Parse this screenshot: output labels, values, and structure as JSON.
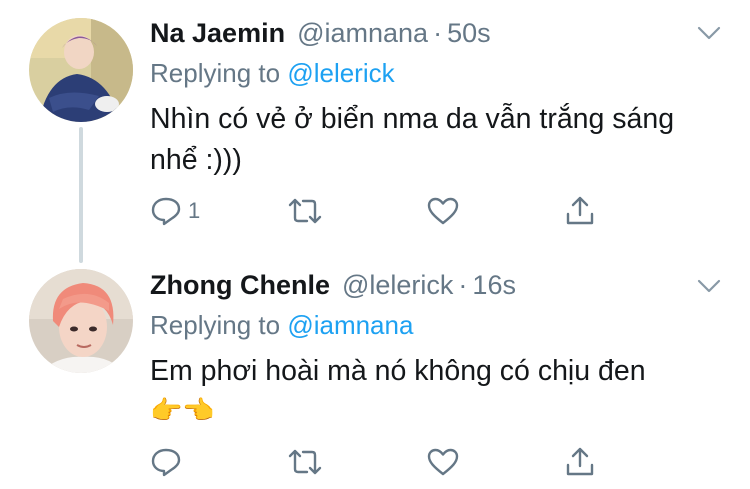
{
  "tweets": [
    {
      "name": "Na Jaemin",
      "handle": "@iamnana",
      "separator": "·",
      "time": "50s",
      "replying_prefix": "Replying to",
      "replying_to": "@lelerick",
      "text": "Nhìn có vẻ ở biển nma da vẫn trắng sáng nhể :)))",
      "emoji": "",
      "reply_count": "1"
    },
    {
      "name": "Zhong Chenle",
      "handle": "@lelerick",
      "separator": "·",
      "time": "16s",
      "replying_prefix": "Replying to",
      "replying_to": "@iamnana",
      "text": "Em phơi hoài mà nó không có chịu đen",
      "emoji": "👉👈",
      "reply_count": ""
    }
  ],
  "colors": {
    "text": "#14171a",
    "secondary": "#657786",
    "accent": "#1da1f2",
    "thread_line": "#cfd9de"
  },
  "icons": [
    "chevron-down-icon",
    "reply-icon",
    "retweet-icon",
    "like-icon",
    "share-icon"
  ]
}
